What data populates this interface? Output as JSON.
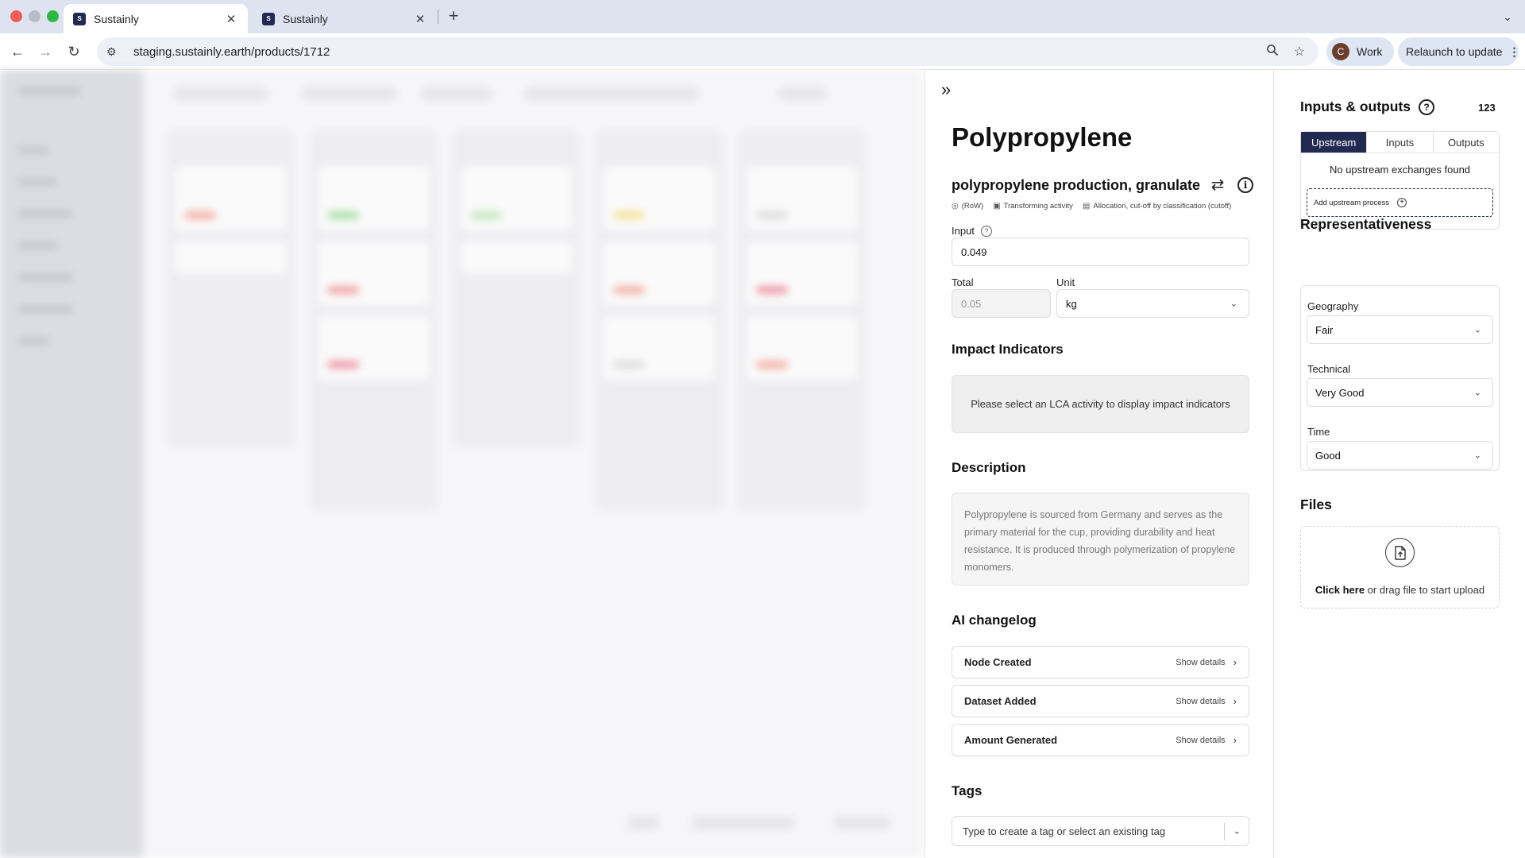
{
  "browser": {
    "tabs": [
      {
        "title": "Sustainly",
        "active": true
      },
      {
        "title": "Sustainly",
        "active": false
      }
    ],
    "url": "staging.sustainly.earth/products/1712",
    "profile_initial": "C",
    "profile_label": "Work",
    "relaunch_label": "Relaunch to update"
  },
  "panel": {
    "title": "Polypropylene",
    "activity_name": "polypropylene production, granulate",
    "meta": {
      "geography": "(RoW)",
      "activity_type": "Transforming activity",
      "allocation": "Allocation, cut-off by classification (cutoff)"
    },
    "input": {
      "label": "Input",
      "value": "0.049"
    },
    "total": {
      "label": "Total",
      "value": "0.05"
    },
    "unit": {
      "label": "Unit",
      "value": "kg"
    },
    "impact": {
      "title": "Impact Indicators",
      "empty_text": "Please select an LCA activity to display impact indicators"
    },
    "description": {
      "title": "Description",
      "text": "Polypropylene is sourced from Germany and serves as the primary material for the cup, providing durability and heat resistance. It is produced through polymerization of propylene monomers."
    },
    "changelog": {
      "title": "AI changelog",
      "items": [
        {
          "title": "Node Created",
          "action": "Show details"
        },
        {
          "title": "Dataset Added",
          "action": "Show details"
        },
        {
          "title": "Amount Generated",
          "action": "Show details"
        }
      ]
    },
    "tags": {
      "title": "Tags",
      "placeholder": "Type to create a tag or select an existing tag"
    }
  },
  "right": {
    "io": {
      "title": "Inputs & outputs",
      "count": "123",
      "tabs": [
        "Upstream",
        "Inputs",
        "Outputs"
      ],
      "empty_text": "No upstream exchanges found",
      "add_label": "Add upstream process"
    },
    "representativeness": {
      "title": "Representativeness",
      "fields": [
        {
          "label": "Geography",
          "value": "Fair"
        },
        {
          "label": "Technical",
          "value": "Very Good"
        },
        {
          "label": "Time",
          "value": "Good"
        }
      ]
    },
    "files": {
      "title": "Files",
      "link_text": "Click here",
      "rest_text": " or drag file to start upload"
    }
  },
  "colors": {
    "accent": "#232a52",
    "chrome_bg": "#dde3ef"
  }
}
